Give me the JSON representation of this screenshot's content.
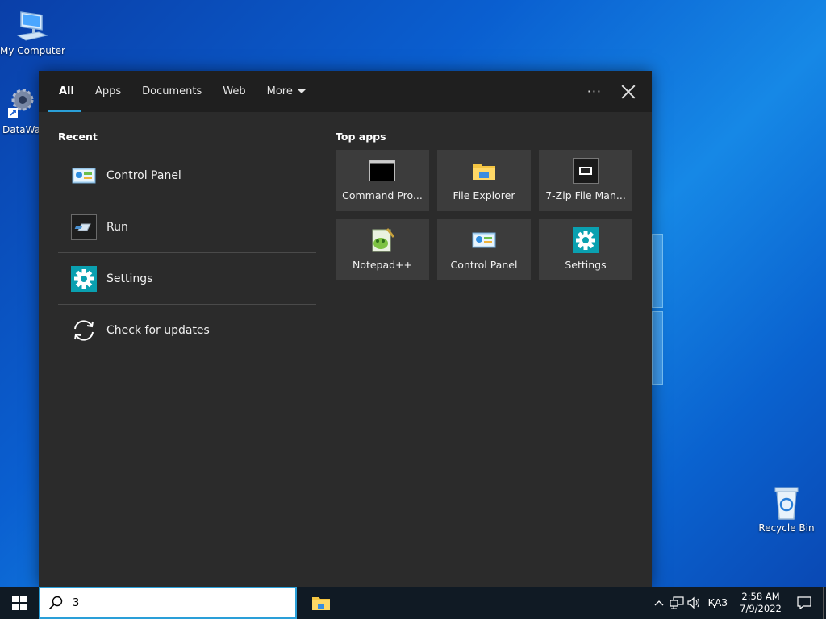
{
  "desktop": {
    "icons": [
      {
        "label": "My Computer"
      },
      {
        "label": "DataWag"
      },
      {
        "label": "Recycle Bin"
      }
    ]
  },
  "search_panel": {
    "tabs": [
      {
        "label": "All"
      },
      {
        "label": "Apps"
      },
      {
        "label": "Documents"
      },
      {
        "label": "Web"
      },
      {
        "label": "More"
      }
    ],
    "more_options_label": "···",
    "recent_title": "Recent",
    "recent_items": [
      {
        "label": "Control Panel",
        "icon": "control-panel-icon"
      },
      {
        "label": "Run",
        "icon": "run-icon"
      },
      {
        "label": "Settings",
        "icon": "settings-gear-icon"
      },
      {
        "label": "Check for updates",
        "icon": "sync-icon"
      }
    ],
    "top_apps_title": "Top apps",
    "top_apps": [
      {
        "label": "Command Pro...",
        "icon": "command-prompt-icon"
      },
      {
        "label": "File Explorer",
        "icon": "folder-icon"
      },
      {
        "label": "7-Zip File Man...",
        "icon": "7zip-icon"
      },
      {
        "label": "Notepad++",
        "icon": "notepadpp-icon"
      },
      {
        "label": "Control Panel",
        "icon": "control-panel-icon"
      },
      {
        "label": "Settings",
        "icon": "settings-gear-icon"
      }
    ]
  },
  "taskbar": {
    "search_value": "3",
    "language": "ҚАЗ",
    "time": "2:58 AM",
    "date": "7/9/2022"
  },
  "colors": {
    "accent": "#2a9fd8",
    "panel_bg": "#2b2b2b",
    "tile_bg": "#3c3c3c",
    "taskbar_bg": "#101a24",
    "settings_teal": "#0aa0b0"
  }
}
